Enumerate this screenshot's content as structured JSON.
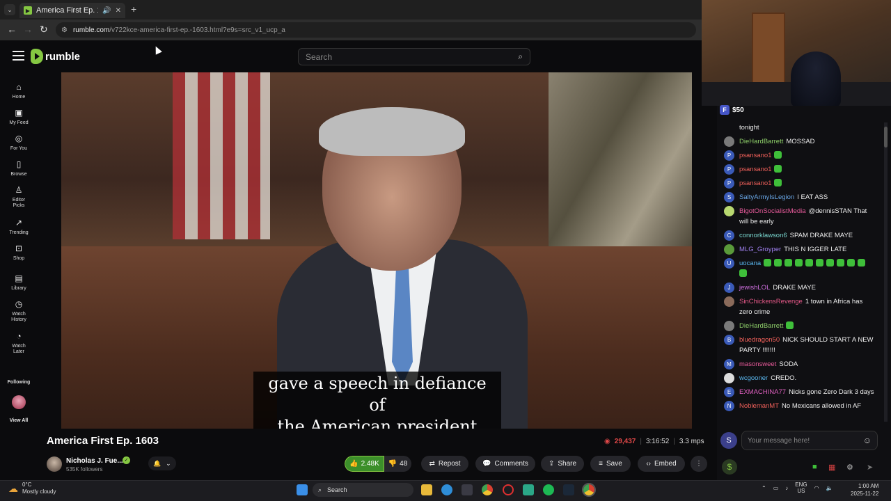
{
  "browser": {
    "tab_title": "America First Ep. 1603",
    "url_host": "rumble.com",
    "url_path": "/v722kce-america-first-ep.-1603.html?e9s=src_v1_ucp_a"
  },
  "header": {
    "logo_text": "rumble",
    "search_placeholder": "Search"
  },
  "sidebar": {
    "items": [
      {
        "label": "Home",
        "icon": "home-icon"
      },
      {
        "label": "My Feed",
        "icon": "feed-icon"
      },
      {
        "label": "For You",
        "icon": "for-you-icon"
      },
      {
        "label": "Browse",
        "icon": "browse-icon"
      },
      {
        "label": "Editor Picks",
        "icon": "editor-picks-icon"
      },
      {
        "label": "Trending",
        "icon": "trending-icon"
      },
      {
        "label": "Shop",
        "icon": "shop-icon"
      },
      {
        "label": "Library",
        "icon": "library-icon"
      },
      {
        "label": "Watch History",
        "icon": "history-icon"
      },
      {
        "label": "Watch Later",
        "icon": "watch-later-icon"
      }
    ],
    "following_label": "Following",
    "view_all_label": "View All"
  },
  "video": {
    "caption_line1": "gave a speech in defiance of",
    "caption_line2": "the American president",
    "title": "America First Ep. 1603",
    "views": "29,437",
    "duration": "3:16:52",
    "bitrate": "3.3 mps"
  },
  "channel": {
    "name": "Nicholas J. Fue...",
    "followers": "535K followers"
  },
  "actions": {
    "likes": "2.48K",
    "dislikes": "48",
    "repost": "Repost",
    "comments": "Comments",
    "share": "Share",
    "save": "Save",
    "embed": "Embed"
  },
  "chat": {
    "tip_amount": "$50",
    "input_placeholder": "Your message here!",
    "avatar_letter": "S",
    "messages": [
      {
        "user": "",
        "text": "tonight",
        "color": "#eeeeee",
        "av": "",
        "avcolor": "transparent",
        "emotes": 0
      },
      {
        "user": "DieHardBarrett",
        "text": "MOSSAD",
        "color": "#8fd06a",
        "av": "",
        "avcolor": "#7a7a7a",
        "emotes": 0
      },
      {
        "user": "psansano1",
        "text": "",
        "color": "#f0605a",
        "av": "P",
        "avcolor": "#3a5ab8",
        "emotes": 1
      },
      {
        "user": "psansano1",
        "text": "",
        "color": "#f0605a",
        "av": "P",
        "avcolor": "#3a5ab8",
        "emotes": 1
      },
      {
        "user": "psansano1",
        "text": "",
        "color": "#f0605a",
        "av": "P",
        "avcolor": "#3a5ab8",
        "emotes": 1
      },
      {
        "user": "SaltyArmyIsLegion",
        "text": "I EAT ASS",
        "color": "#6aa8e8",
        "av": "S",
        "avcolor": "#3a5ab8",
        "emotes": 0
      },
      {
        "user": "BigotOnSocialistMedia",
        "text": "@dennisSTAN That will be early",
        "color": "#e65a9a",
        "av": "",
        "avcolor": "#b8d870",
        "emotes": 0
      },
      {
        "user": "connorklawson6",
        "text": "SPAM DRAKE MAYE",
        "color": "#7ad8d0",
        "av": "C",
        "avcolor": "#3a5ab8",
        "emotes": 0
      },
      {
        "user": "MLG_Groyper",
        "text": "THIS N IGGER LATE",
        "color": "#a080f0",
        "av": "",
        "avcolor": "#5a9a3a",
        "emotes": 0
      },
      {
        "user": "uocana",
        "text": "",
        "color": "#5ab8f0",
        "av": "U",
        "avcolor": "#3a5ab8",
        "emotes": 11
      },
      {
        "user": "jewishLOL",
        "text": "DRAKE MAYE",
        "color": "#d070e0",
        "av": "J",
        "avcolor": "#3a5ab8",
        "emotes": 0
      },
      {
        "user": "SinChickensRevenge",
        "text": "1 town in Africa has zero crime",
        "color": "#e85a8a",
        "av": "",
        "avcolor": "#8a6a5a",
        "emotes": 0
      },
      {
        "user": "DieHardBarrett",
        "text": "",
        "color": "#8fd06a",
        "av": "",
        "avcolor": "#7a7a7a",
        "emotes": 1
      },
      {
        "user": "bluedragon50",
        "text": "NICK SHOULD START A NEW PARTY !!!!!!!",
        "color": "#f0605a",
        "av": "B",
        "avcolor": "#3a5ab8",
        "emotes": 0
      },
      {
        "user": "masonsweet",
        "text": "SODA",
        "color": "#e85a9a",
        "av": "M",
        "avcolor": "#3a5ab8",
        "emotes": 0
      },
      {
        "user": "wcgooner",
        "text": "CREDO.",
        "color": "#5ab8f0",
        "av": "",
        "avcolor": "#dddddd",
        "emotes": 0
      },
      {
        "user": "EXMACHINA77",
        "text": "Nicks gone Zero Dark 3 days",
        "color": "#e060c0",
        "av": "E",
        "avcolor": "#3a5ab8",
        "emotes": 0
      },
      {
        "user": "NoblemanMT",
        "text": "No Mexicans allowed in AF",
        "color": "#f0605a",
        "av": "N",
        "avcolor": "#3a5ab8",
        "emotes": 0
      }
    ]
  },
  "taskbar": {
    "temp": "0°C",
    "weather": "Mostly cloudy",
    "search_label": "Search",
    "lang_line1": "ENG",
    "lang_line2": "US",
    "time": "1:00 AM",
    "date": "2025-11-22"
  },
  "colors": {
    "brand_green": "#85c742",
    "views_red": "#e04848",
    "background": "#0b0b0d"
  }
}
